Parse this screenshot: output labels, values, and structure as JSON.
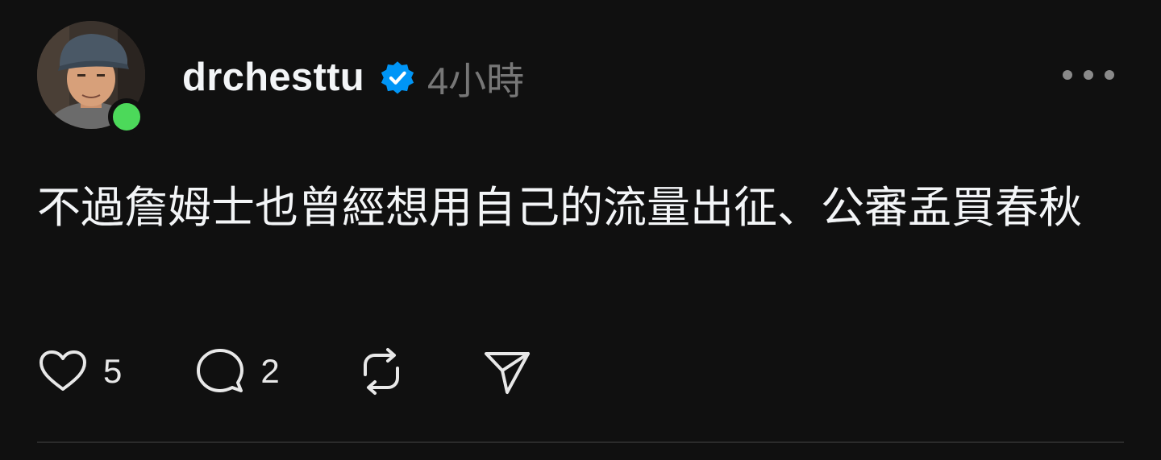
{
  "post": {
    "username": "drchesttu",
    "timestamp": "4小時",
    "verified": true,
    "text": "不過詹姆士也曾經想用自己的流量出征、公審孟買春秋",
    "likes": "5",
    "replies": "2"
  },
  "colors": {
    "background": "#101010",
    "online": "#4cd95a",
    "verified": "#0095f6"
  },
  "icons": [
    "heart-icon",
    "comment-icon",
    "repost-icon",
    "share-icon",
    "verified-icon",
    "more-icon"
  ]
}
